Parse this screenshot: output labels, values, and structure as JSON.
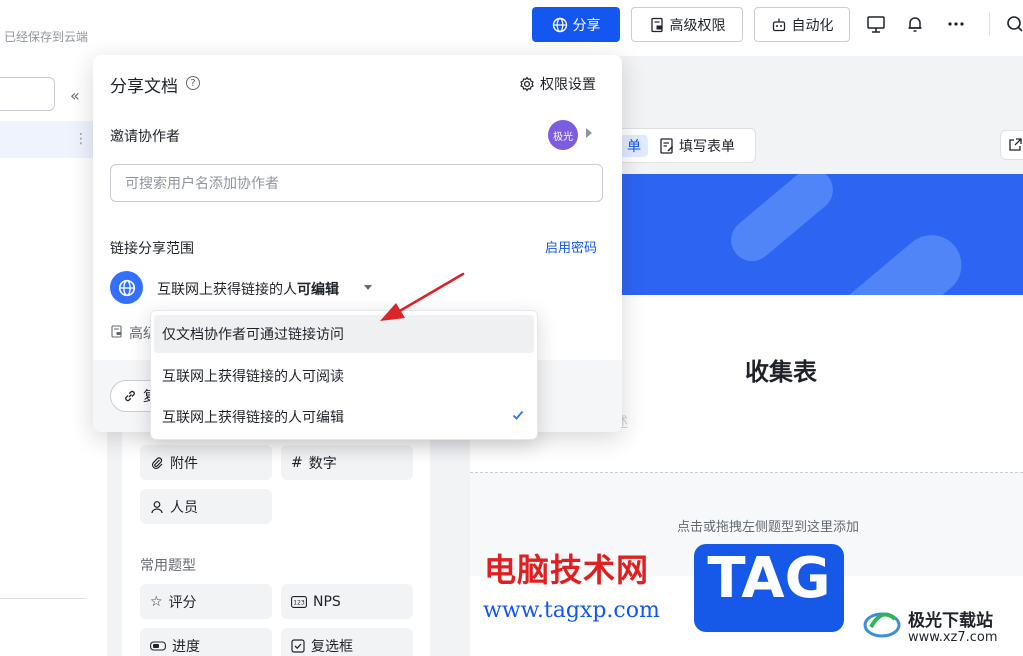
{
  "header": {
    "saved_status": "已经保存到云端",
    "share_label": "分享",
    "advanced_permissions_label": "高级权限",
    "automation_label": "自动化",
    "icons": [
      "globe-icon",
      "permission-icon",
      "robot-icon",
      "presentation-icon",
      "bell-icon",
      "more-icon",
      "search-icon"
    ]
  },
  "sidebar": {
    "collapse_glyph": "«",
    "more_glyph": "⋮"
  },
  "share_popover": {
    "title": "分享文档",
    "help_glyph": "?",
    "permission_settings": "权限设置",
    "invite_label": "邀请协作者",
    "avatar_text": "极光",
    "collaborator_placeholder": "可搜索用户名添加协作者",
    "link_scope_label": "链接分享范围",
    "enable_password": "启用密码",
    "selected_scope_prefix": "互联网上获得链接的人",
    "selected_scope_bold": "可编辑",
    "advanced_text": "高级",
    "copy_link_label": "复"
  },
  "scope_menu": {
    "options": [
      {
        "label": "仅文档协作者可通过链接访问",
        "highlighted": true,
        "selected": false
      },
      {
        "label": "互联网上获得链接的人可阅读",
        "highlighted": false,
        "selected": false
      },
      {
        "label": "互联网上获得链接的人可编辑",
        "highlighted": false,
        "selected": true
      }
    ]
  },
  "question_types": {
    "basic": [
      {
        "icon": "paperclip-icon",
        "label": "附件"
      },
      {
        "icon": "hash-icon",
        "glyph": "#",
        "label": "数字"
      },
      {
        "icon": "person-icon",
        "label": "人员"
      }
    ],
    "common_title": "常用题型",
    "common": [
      {
        "icon": "star-icon",
        "glyph": "☆",
        "label": "评分"
      },
      {
        "icon": "nps-icon",
        "label": "NPS"
      },
      {
        "icon": "progress-icon",
        "label": "进度"
      },
      {
        "icon": "checkbox-icon",
        "label": "复选框"
      }
    ]
  },
  "form": {
    "tab_active_remnant": "单",
    "tab_fill": "填写表单",
    "title": "收集表",
    "description_hint": "述",
    "drop_hint": "点击或拖拽左侧题型到这里添加"
  },
  "watermarks": {
    "site_name": "电脑技术网",
    "site_url": "www.tagxp.com",
    "tag": "TAG",
    "xz_name": "极光下载站",
    "xz_url": "www.xz7.com"
  },
  "colors": {
    "accent": "#1456f0",
    "banner": "#2e64f2",
    "arrow": "#d9242a",
    "watermark_red": "#e02020"
  }
}
